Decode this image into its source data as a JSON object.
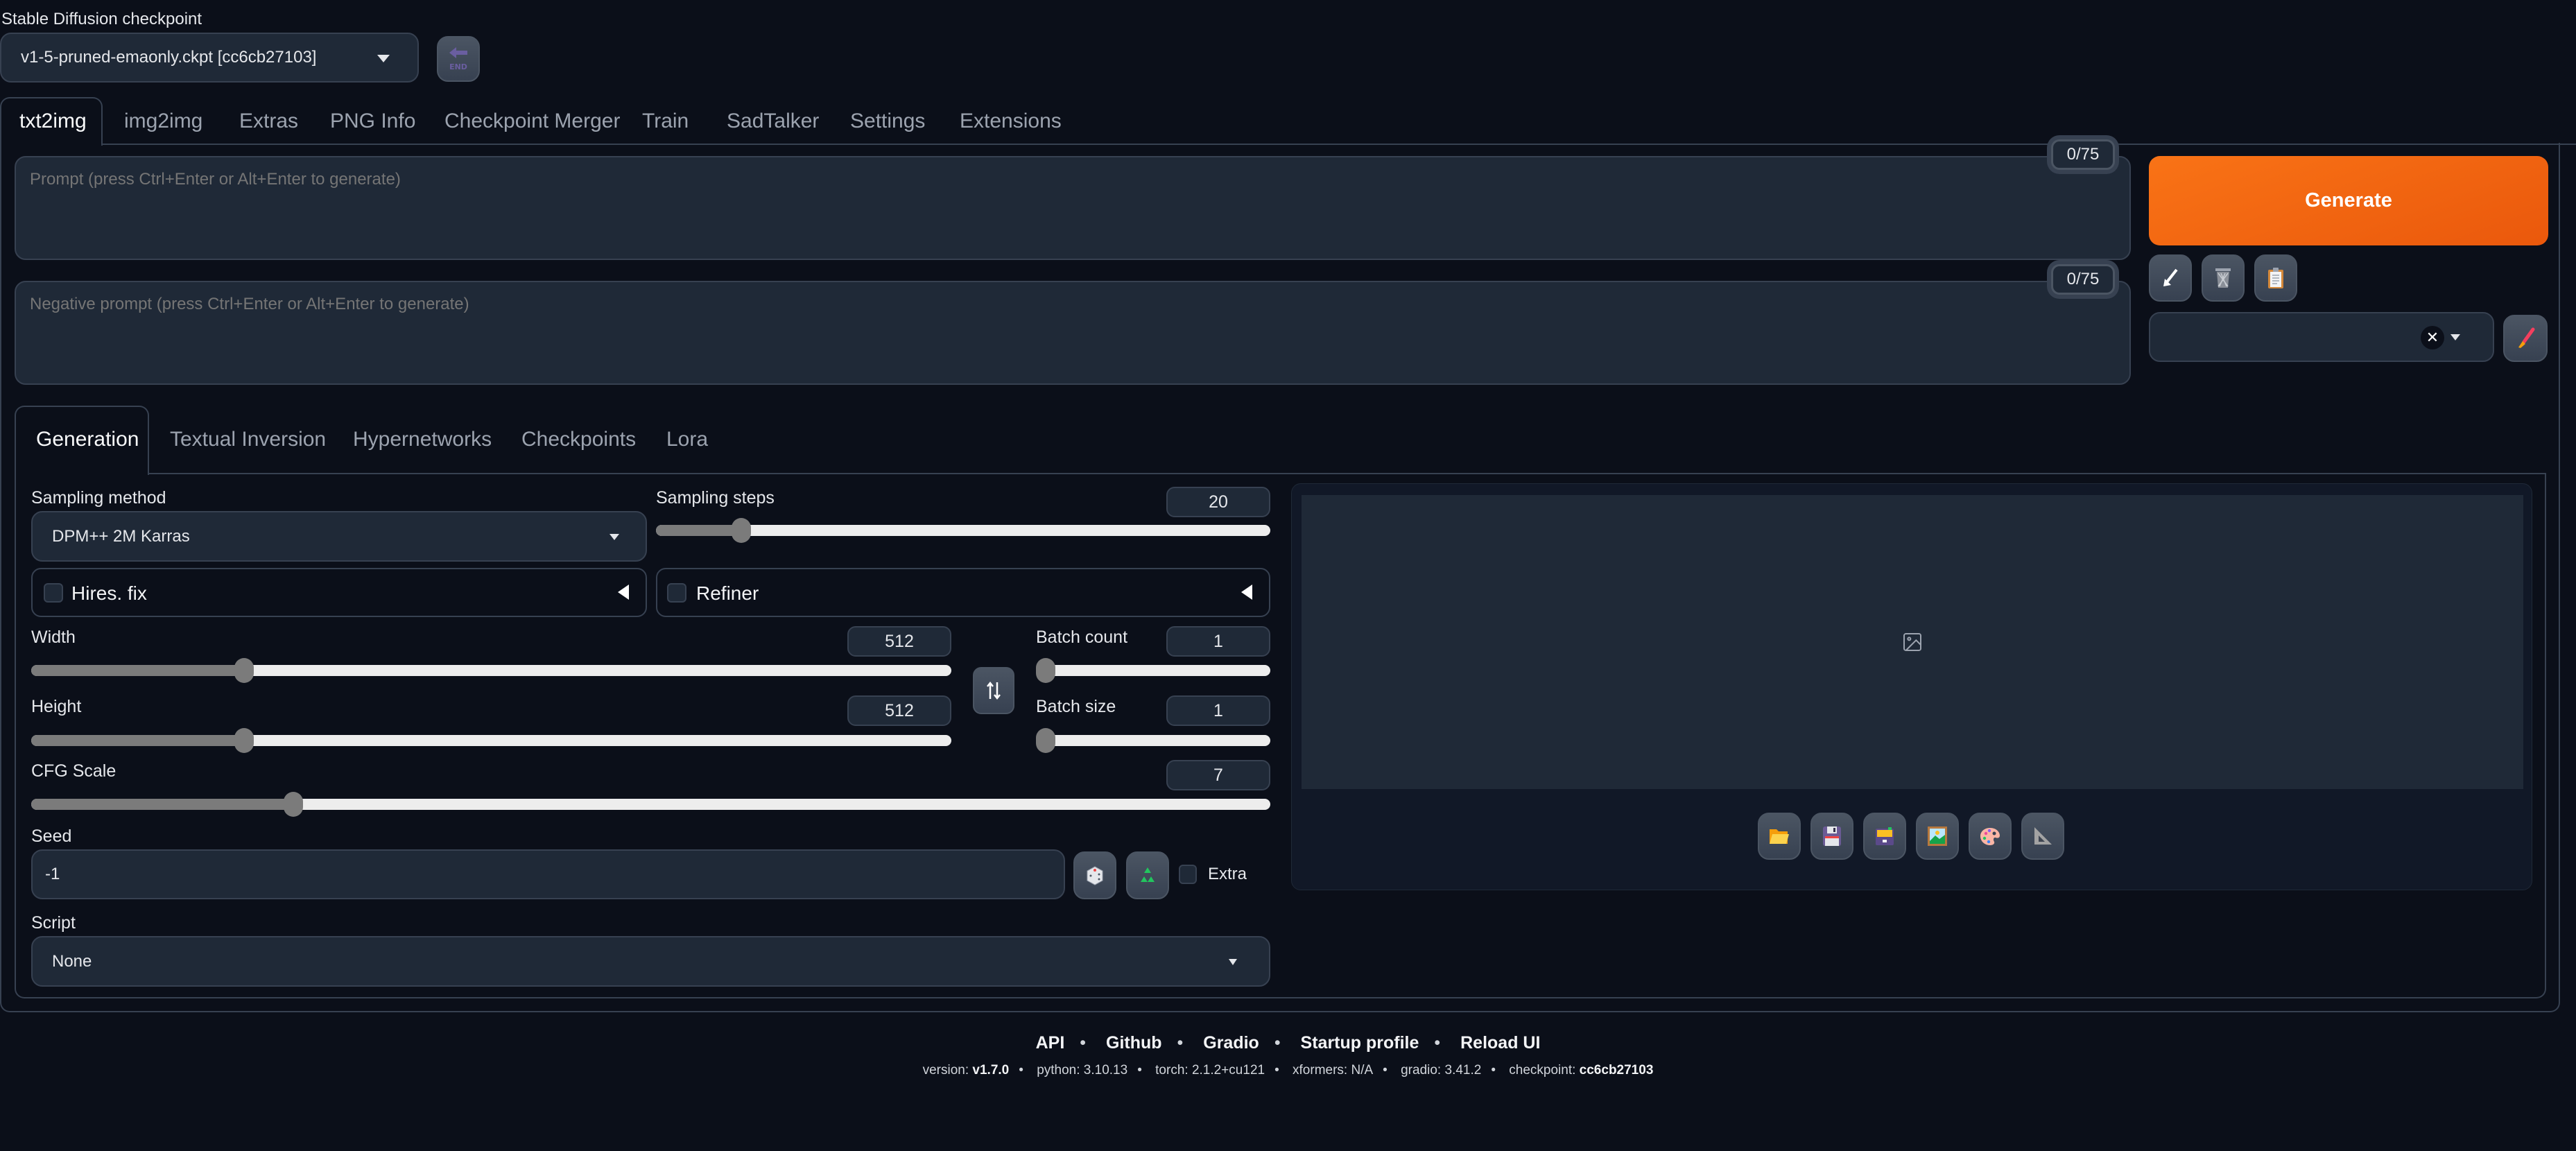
{
  "checkpoint": {
    "label": "Stable Diffusion checkpoint",
    "value": "v1-5-pruned-emaonly.ckpt [cc6cb27103]",
    "refresh_icon": "arrow-end-icon"
  },
  "main_tabs": [
    {
      "label": "txt2img",
      "active": true
    },
    {
      "label": "img2img"
    },
    {
      "label": "Extras"
    },
    {
      "label": "PNG Info"
    },
    {
      "label": "Checkpoint Merger"
    },
    {
      "label": "Train"
    },
    {
      "label": "SadTalker"
    },
    {
      "label": "Settings"
    },
    {
      "label": "Extensions"
    }
  ],
  "prompt": {
    "placeholder": "Prompt (press Ctrl+Enter or Alt+Enter to generate)",
    "value": "",
    "token_counter": "0/75"
  },
  "negative_prompt": {
    "placeholder": "Negative prompt (press Ctrl+Enter or Alt+Enter to generate)",
    "value": "",
    "token_counter": "0/75"
  },
  "actions": {
    "generate_label": "Generate",
    "generate_color": "#f97316",
    "tool_icons": [
      "arrow-read-params-icon",
      "trash-icon",
      "clipboard-icon"
    ],
    "styles_value": "",
    "clear_icon": "close-icon",
    "edit_styles_icon": "paintbrush-icon"
  },
  "sub_tabs": [
    {
      "label": "Generation",
      "active": true
    },
    {
      "label": "Textual Inversion"
    },
    {
      "label": "Hypernetworks"
    },
    {
      "label": "Checkpoints"
    },
    {
      "label": "Lora"
    }
  ],
  "generation": {
    "sampling_method": {
      "label": "Sampling method",
      "value": "DPM++ 2M Karras"
    },
    "sampling_steps": {
      "label": "Sampling steps",
      "value": "20",
      "min": 1,
      "max": 150
    },
    "hires_fix": {
      "label": "Hires. fix",
      "checked": false
    },
    "refiner": {
      "label": "Refiner",
      "checked": false
    },
    "width": {
      "label": "Width",
      "value": "512",
      "min": 64,
      "max": 2048
    },
    "height": {
      "label": "Height",
      "value": "512",
      "min": 64,
      "max": 2048
    },
    "swap_icon": "swap-dimensions-icon",
    "batch_count": {
      "label": "Batch count",
      "value": "1",
      "min": 1,
      "max": 100
    },
    "batch_size": {
      "label": "Batch size",
      "value": "1",
      "min": 1,
      "max": 8
    },
    "cfg_scale": {
      "label": "CFG Scale",
      "value": "7",
      "min": 1,
      "max": 30
    },
    "seed": {
      "label": "Seed",
      "value": "-1",
      "extra_label": "Extra",
      "extra_checked": false
    },
    "script": {
      "label": "Script",
      "value": "None"
    }
  },
  "gallery": {
    "placeholder_icon": "image-icon",
    "buttons": [
      {
        "icon": "folder-icon",
        "name": "open-folder-button"
      },
      {
        "icon": "floppy-disk-icon",
        "name": "save-button"
      },
      {
        "icon": "archive-box-icon",
        "name": "zip-button"
      },
      {
        "icon": "framed-picture-icon",
        "name": "send-to-img2img-button"
      },
      {
        "icon": "palette-icon",
        "name": "send-to-inpaint-button"
      },
      {
        "icon": "triangle-ruler-icon",
        "name": "send-to-extras-button"
      }
    ]
  },
  "footer": {
    "links": [
      "API",
      "Github",
      "Gradio",
      "Startup profile",
      "Reload UI"
    ],
    "version_label": "version:",
    "version": "v1.7.0",
    "python_label": "python:",
    "python": "3.10.13",
    "torch_label": "torch:",
    "torch": "2.1.2+cu121",
    "xformers_label": "xformers:",
    "xformers": "N/A",
    "gradio_label": "gradio:",
    "gradio": "3.41.2",
    "checkpoint_label": "checkpoint:",
    "checkpoint": "cc6cb27103"
  }
}
